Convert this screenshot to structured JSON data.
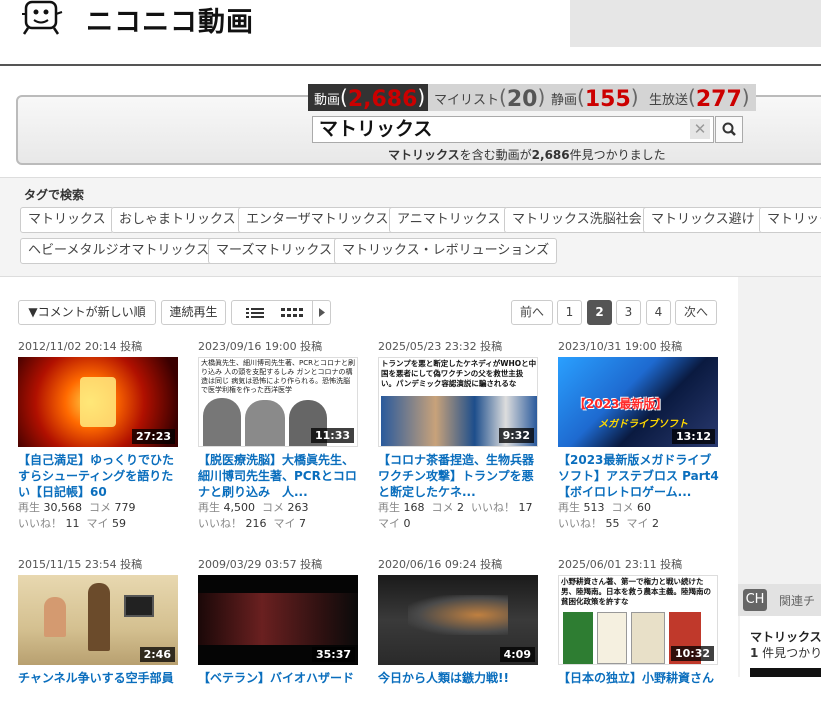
{
  "header": {
    "logo_text": "ニコニコ動画"
  },
  "search": {
    "tabs": [
      {
        "label": "動画",
        "count": "2,686"
      },
      {
        "label": "マイリスト",
        "count": "20"
      },
      {
        "label": "静画",
        "count": "155"
      },
      {
        "label": "生放送",
        "count": "277"
      }
    ],
    "query": "マトリックス",
    "clear_symbol": "✕",
    "result_prefix": "マトリックス",
    "result_middle": "を含む動画が",
    "result_count": "2,686",
    "result_suffix": "件見つかりました"
  },
  "tags": {
    "heading": "タグで検索",
    "items": [
      "マトリックス",
      "おしゃまトリックス",
      "エンターザマトリックス",
      "アニマトリックス",
      "マトリックス洗脳社会",
      "マトリックス避け",
      "マトリック",
      "ヘビーメタルジオマトリックス",
      "マーズマトリックス",
      "マトリックス・レボリューションズ"
    ]
  },
  "toolbar": {
    "sort_label": "▼コメントが新しい順",
    "continuous_label": "連続再生",
    "prev_label": "前へ",
    "pages": [
      "1",
      "2",
      "3",
      "4"
    ],
    "current_page": "2",
    "next_label": "次へ"
  },
  "videos": [
    {
      "date": "2012/11/02 20:14",
      "posted": "投稿",
      "duration": "27:23",
      "title": "【自己満足】ゆっくりでひたすらシューティングを語りたい【日記帳】60",
      "views_label": "再生",
      "views": "30,568",
      "comments_label": "コメ",
      "comments": "779",
      "likes_label": "いいね！",
      "likes": "11",
      "mylist_label": "マイ",
      "mylist": "59",
      "thumb_colors": [
        "#5a0000",
        "#e03000",
        "#ffb000"
      ]
    },
    {
      "date": "2023/09/16 19:00",
      "posted": "投稿",
      "duration": "11:33",
      "title": "【脱医療洗脳】大橋眞先生、細川博司先生著、PCRとコロナと刷り込み　人...",
      "views_label": "再生",
      "views": "4,500",
      "comments_label": "コメ",
      "comments": "263",
      "likes_label": "いいね！",
      "likes": "216",
      "mylist_label": "マイ",
      "mylist": "7",
      "thumb_caption": "大橋眞先生、細川博司先生著、PCRとコロナと刷り込み 人の頭を支配するしみ ガンとコロナの構造は同じ 病気は恐怖により作られる。恐怖洗脳で医学利権を作った西洋医学",
      "thumb_colors": [
        "#ffffff",
        "#e8e8e8",
        "#555555"
      ]
    },
    {
      "date": "2025/05/23 23:32",
      "posted": "投稿",
      "duration": "9:32",
      "title": "【コロナ茶番捏造、生物兵器ワクチン攻撃】トランプを悪と断定したケネ...",
      "views_label": "再生",
      "views": "168",
      "comments_label": "コメ",
      "comments": "2",
      "likes_label": "いいね！",
      "likes": "17",
      "mylist_label": "マイ",
      "mylist": "0",
      "thumb_caption": "トランプを悪と断定したケネディがWHOと中国を悪者にして偽ワクチンの父を救世主扱い。パンデミック容認演説に騙されるな",
      "thumb_colors": [
        "#ffffff",
        "#1d4e8c",
        "#c8a27a"
      ]
    },
    {
      "date": "2023/10/31 19:00",
      "posted": "投稿",
      "duration": "13:12",
      "title": "【2023最新版メガドライブソフト】アステブロス Part4【ボイロレトロゲーム...",
      "views_label": "再生",
      "views": "513",
      "comments_label": "コメ",
      "comments": "60",
      "likes_label": "いいね！",
      "likes": "55",
      "mylist_label": "マイ",
      "mylist": "2",
      "thumb_caption": "【2023最新版】",
      "thumb_caption2": "メガドライブソフト",
      "thumb_colors": [
        "#1e90ff",
        "#0a1a40",
        "#ff2a2a"
      ]
    },
    {
      "date": "2015/11/15 23:54",
      "posted": "投稿",
      "duration": "2:46",
      "title": "チャンネル争いする空手部員",
      "thumb_colors": [
        "#c8b48a",
        "#e8d8b0",
        "#6b4b2b"
      ]
    },
    {
      "date": "2009/03/29 03:57",
      "posted": "投稿",
      "duration": "35:37",
      "title": "【ベテラン】バイオハザード",
      "thumb_colors": [
        "#0a0a0a",
        "#3a1010",
        "#9a2a2a"
      ]
    },
    {
      "date": "2020/06/16 09:24",
      "posted": "投稿",
      "duration": "4:09",
      "title": "今日から人類は鏃力戦!!",
      "thumb_colors": [
        "#1a1a1a",
        "#444444",
        "#8a6a3a"
      ]
    },
    {
      "date": "2025/06/01 23:11",
      "posted": "投稿",
      "duration": "10:32",
      "title": "【日本の独立】小野耕資さん",
      "thumb_caption": "小野耕資さん著、第一で権力と戦い続けた男、陸羯南。日本を救う農本主義。陸羯南の貧困化政策を許すな",
      "thumb_colors": [
        "#ffffff",
        "#c0392b",
        "#2e7d32"
      ]
    }
  ],
  "related": {
    "label": "関連チ",
    "query": "マトリックス",
    "count": "1",
    "count_suffix": " 件見つかり"
  }
}
